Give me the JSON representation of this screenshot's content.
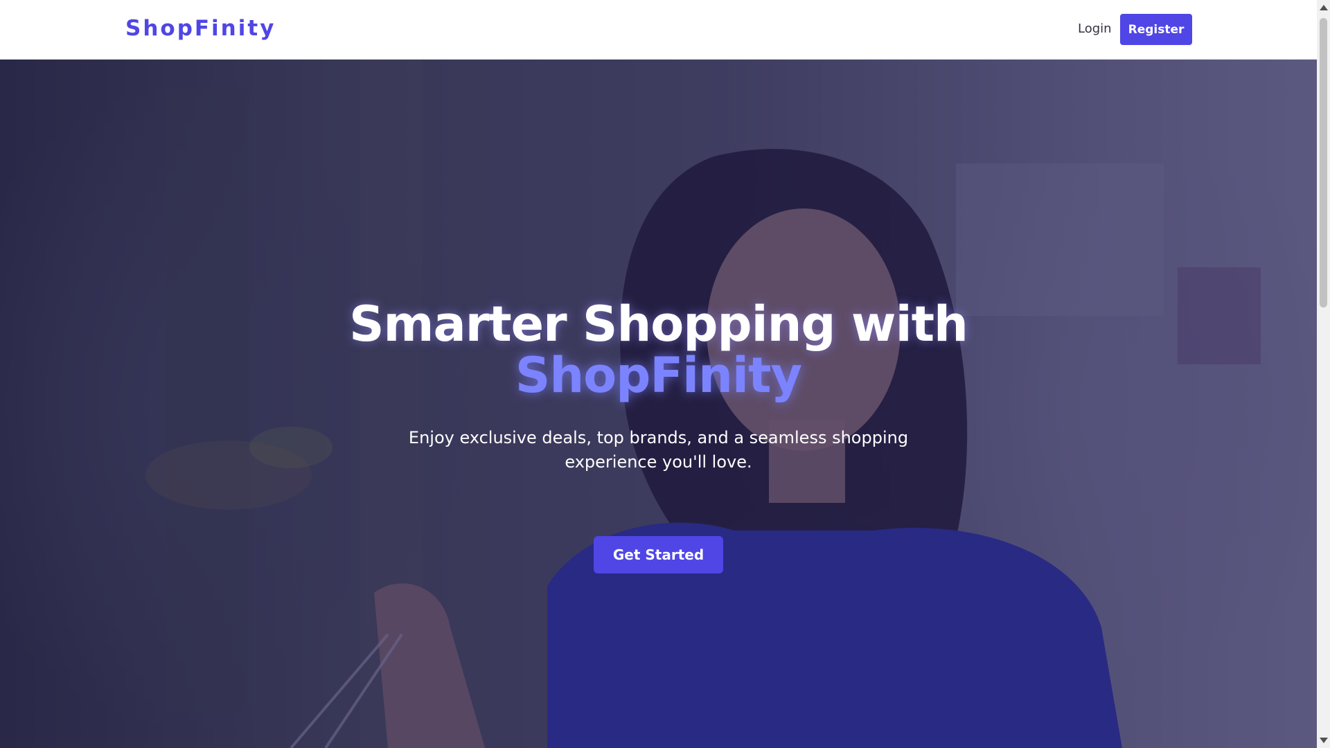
{
  "header": {
    "logo": "ShopFinity",
    "login_label": "Login",
    "register_label": "Register"
  },
  "hero": {
    "title_line1": "Smarter Shopping with",
    "title_brand": "ShopFinity",
    "subtitle": "Enjoy exclusive deals, top brands, and a seamless shopping experience you'll love.",
    "cta_label": "Get Started"
  },
  "colors": {
    "primary": "#4f46e5",
    "brand_highlight": "#7c83ff",
    "overlay": "#28225a"
  },
  "icons": {
    "scroll_up": "chevron-up-icon",
    "scroll_down": "chevron-down-icon"
  }
}
